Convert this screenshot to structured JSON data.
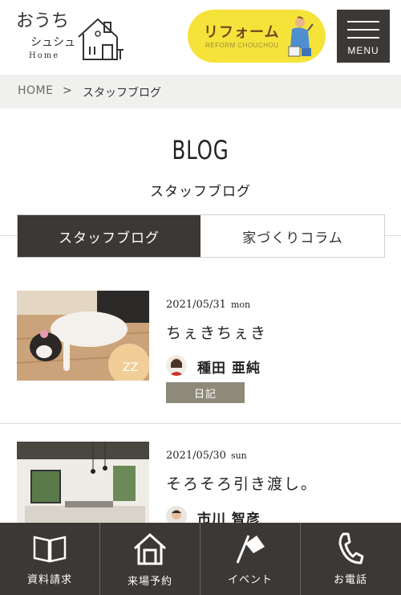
{
  "header": {
    "logo_line1": "おうち",
    "logo_line2": "シュシュ",
    "logo_home": "Home",
    "reform": {
      "title": "リフォーム",
      "subtitle": "REFORM CHOUCHOU"
    },
    "menu_label": "MENU"
  },
  "breadcrumb": {
    "home": "HOME",
    "separator": ">",
    "current": "スタッフブログ"
  },
  "page": {
    "title": "BLOG",
    "subtitle": "スタッフブログ"
  },
  "tabs": [
    {
      "label": "スタッフブログ",
      "active": true
    },
    {
      "label": "家づくりコラム",
      "active": false
    }
  ],
  "posts": [
    {
      "date": "2021/05/31",
      "day": "mon",
      "title": "ちぇきちぇき",
      "author": "種田 亜純",
      "category": "日記"
    },
    {
      "date": "2021/05/30",
      "day": "sun",
      "title": "そろそろ引き渡し。",
      "author": "市川 智彦"
    }
  ],
  "bottom_nav": [
    {
      "label": "資料請求",
      "icon": "book-icon"
    },
    {
      "label": "来場予約",
      "icon": "house-icon"
    },
    {
      "label": "イベント",
      "icon": "flag-icon"
    },
    {
      "label": "お電話",
      "icon": "phone-icon"
    }
  ],
  "colors": {
    "dark": "#3b3836",
    "reform_yellow": "#f6e33a",
    "badge": "#8e8a7a",
    "breadcrumb_bg": "#f0f0ef"
  }
}
